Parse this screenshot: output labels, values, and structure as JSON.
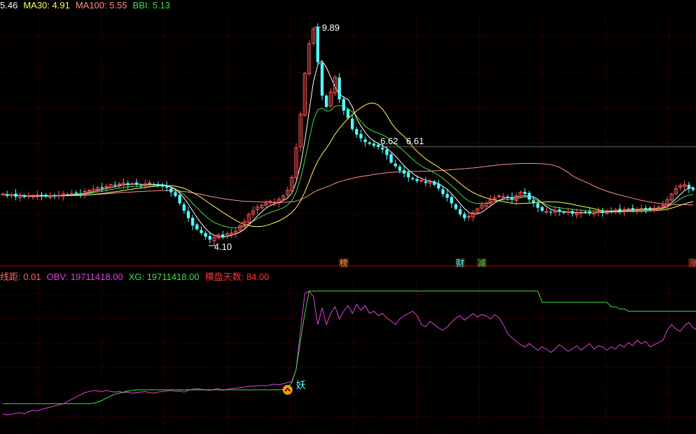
{
  "colors": {
    "background": "#000000",
    "grid": "#8b0000",
    "candle_up": "#ff5555",
    "candle_down": "#55ffff",
    "ma_short": "#ffffff",
    "ma30": "#ffff55",
    "ma100": "#ff8f8f",
    "bbi": "#44dd44",
    "obv": "#dd44dd",
    "xg": "#44dd44",
    "hengpan": "#ff3333",
    "yao_icon": "#ff9a00"
  },
  "main_panel": {
    "legend": [
      {
        "label": "",
        "value": "5.46",
        "color": "#ffffff"
      },
      {
        "label": "MA30: ",
        "value": "4.91",
        "color": "#ffff55"
      },
      {
        "label": "MA100: ",
        "value": "5.55",
        "color": "#ff8f8f"
      },
      {
        "label": "BBI: ",
        "value": "5.13",
        "color": "#44dd44"
      }
    ],
    "annotations": {
      "high_label": "9.89",
      "low_label": "4.10",
      "mid_label_1": "6.62",
      "mid_label_2": "6.61"
    },
    "event_tags": [
      {
        "text": "榜",
        "color": "#ff9a3c"
      },
      {
        "text": "财",
        "color": "#55ffff"
      },
      {
        "text": "减",
        "color": "#44dd44"
      },
      {
        "text": "涨",
        "color": "#ff4444"
      }
    ]
  },
  "sub_panel": {
    "legend": [
      {
        "label": "线距: ",
        "value": "0.01",
        "color": "#ff6666"
      },
      {
        "label": "OBV: ",
        "value": "19711418.00",
        "color": "#dd44dd"
      },
      {
        "label": "XG: ",
        "value": "19711418.00",
        "color": "#44dd44"
      },
      {
        "label": "横盘天数: ",
        "value": "84.00",
        "color": "#ff3333"
      }
    ],
    "signal_label": "妖"
  },
  "chart_data": [
    {
      "type": "candlestick",
      "panel": "price",
      "ylim": [
        3.6,
        10.2
      ],
      "bar_count": 166,
      "close": [
        5.35,
        5.3,
        5.33,
        5.28,
        5.31,
        5.27,
        5.3,
        5.29,
        5.32,
        5.3,
        5.28,
        5.31,
        5.29,
        5.32,
        5.35,
        5.33,
        5.36,
        5.38,
        5.35,
        5.42,
        5.45,
        5.48,
        5.52,
        5.5,
        5.55,
        5.6,
        5.58,
        5.62,
        5.65,
        5.6,
        5.63,
        5.6,
        5.57,
        5.62,
        5.65,
        5.6,
        5.58,
        5.55,
        5.52,
        5.4,
        5.3,
        5.1,
        4.9,
        4.7,
        4.5,
        4.4,
        4.3,
        4.2,
        4.12,
        4.18,
        4.25,
        4.2,
        4.28,
        4.3,
        4.35,
        4.5,
        4.6,
        4.8,
        4.9,
        5.0,
        5.05,
        5.1,
        5.15,
        5.12,
        5.2,
        5.3,
        5.45,
        5.8,
        6.6,
        7.5,
        8.6,
        9.4,
        9.8,
        8.9,
        8.0,
        7.7,
        8.1,
        8.5,
        7.9,
        7.6,
        7.4,
        7.1,
        6.95,
        6.85,
        6.75,
        6.7,
        6.65,
        6.62,
        6.55,
        6.4,
        6.2,
        6.1,
        5.98,
        5.9,
        5.8,
        5.75,
        5.7,
        5.72,
        5.65,
        5.68,
        5.6,
        5.5,
        5.35,
        5.25,
        5.1,
        4.95,
        4.8,
        4.7,
        4.75,
        4.85,
        4.95,
        5.05,
        5.1,
        5.2,
        5.25,
        5.3,
        5.28,
        5.25,
        5.2,
        5.3,
        5.4,
        5.35,
        5.2,
        5.1,
        4.98,
        4.9,
        4.88,
        4.85,
        4.9,
        4.88,
        4.85,
        4.87,
        4.82,
        4.84,
        4.86,
        4.85,
        4.83,
        4.85,
        4.88,
        4.86,
        4.9,
        4.88,
        4.92,
        4.9,
        4.93,
        4.95,
        4.92,
        4.94,
        4.96,
        4.95,
        4.93,
        4.97,
        5.0,
        5.05,
        5.2,
        5.35,
        5.5,
        5.58,
        5.6,
        5.5,
        5.46
      ],
      "overlays": [
        {
          "name": "MA30",
          "value_label": "4.91"
        },
        {
          "name": "MA100",
          "value_label": "5.55"
        },
        {
          "name": "BBI",
          "value_label": "5.13"
        }
      ]
    },
    {
      "type": "line",
      "panel": "indicator",
      "series": [
        {
          "name": "OBV",
          "values": [
            3.0,
            2.9,
            2.95,
            3.05,
            3.1,
            3.0,
            3.2,
            3.3,
            3.25,
            3.4,
            3.5,
            3.6,
            3.7,
            3.8,
            3.9,
            4.1,
            4.3,
            4.5,
            4.7,
            4.9,
            5.0,
            5.1,
            5.05,
            5.0,
            5.1,
            5.0,
            4.95,
            5.0,
            4.9,
            4.95,
            4.85,
            4.9,
            4.95,
            5.0,
            4.9,
            4.85,
            4.95,
            5.0,
            5.05,
            5.1,
            5.0,
            5.05,
            4.95,
            5.1,
            5.2,
            5.25,
            5.2,
            5.15,
            5.1,
            5.2,
            5.25,
            5.1,
            5.2,
            5.25,
            5.3,
            5.35,
            5.4,
            5.45,
            5.5,
            5.5,
            5.55,
            5.5,
            5.6,
            5.65,
            5.6,
            5.7,
            5.8,
            5.9,
            7.0,
            10.5,
            13.8,
            14.0,
            13.5,
            11.0,
            12.5,
            11.0,
            12.0,
            12.6,
            11.5,
            12.2,
            12.7,
            12.0,
            12.8,
            12.3,
            12.7,
            12.0,
            12.2,
            11.8,
            12.0,
            11.6,
            11.3,
            11.0,
            11.5,
            11.8,
            12.0,
            12.2,
            11.8,
            11.0,
            10.8,
            11.3,
            11.0,
            10.7,
            10.5,
            10.8,
            11.2,
            11.6,
            11.8,
            11.4,
            11.7,
            12.0,
            11.7,
            11.9,
            11.8,
            11.5,
            11.9,
            11.6,
            11.0,
            10.2,
            9.8,
            9.5,
            9.2,
            9.0,
            9.3,
            9.0,
            8.7,
            9.0,
            8.8,
            8.5,
            8.8,
            9.2,
            8.9,
            8.6,
            8.8,
            9.1,
            8.7,
            9.0,
            9.3,
            8.8,
            9.1,
            9.0,
            8.7,
            9.0,
            8.8,
            9.2,
            9.0,
            9.4,
            9.1,
            9.6,
            9.3,
            9.5,
            9.0,
            9.2,
            9.4,
            9.6,
            10.5,
            11.0,
            10.6,
            10.4,
            10.9,
            11.2,
            10.7,
            10.5
          ]
        },
        {
          "name": "XG",
          "values": [
            3.9,
            3.9,
            3.9,
            3.9,
            3.9,
            3.9,
            3.9,
            3.9,
            3.9,
            3.9,
            3.9,
            3.9,
            3.9,
            3.9,
            3.9,
            3.9,
            3.9,
            3.9,
            3.9,
            3.9,
            3.9,
            3.95,
            4.05,
            4.2,
            4.4,
            4.6,
            4.75,
            4.85,
            4.95,
            5.05,
            5.1,
            5.15,
            5.15,
            5.15,
            5.15,
            5.15,
            5.15,
            5.15,
            5.15,
            5.15,
            5.15,
            5.15,
            5.15,
            5.15,
            5.15,
            5.15,
            5.15,
            5.15,
            5.15,
            5.15,
            5.15,
            5.15,
            5.15,
            5.15,
            5.15,
            5.15,
            5.15,
            5.15,
            5.15,
            5.15,
            5.15,
            5.15,
            5.15,
            5.15,
            5.15,
            5.2,
            5.4,
            5.8,
            7.0,
            9.6,
            12.0,
            14.0,
            14.0,
            14.0,
            14.0,
            14.0,
            14.0,
            14.0,
            14.0,
            14.0,
            14.0,
            14.0,
            14.0,
            14.0,
            14.0,
            14.0,
            14.0,
            14.0,
            14.0,
            14.0,
            14.0,
            14.0,
            14.0,
            14.0,
            14.0,
            14.0,
            14.0,
            14.0,
            14.0,
            14.0,
            14.0,
            14.0,
            14.0,
            14.0,
            14.0,
            14.0,
            14.0,
            14.0,
            14.0,
            14.0,
            14.0,
            14.0,
            14.0,
            14.0,
            14.0,
            14.0,
            14.0,
            14.0,
            14.0,
            14.0,
            14.0,
            14.0,
            14.0,
            14.0,
            14.0,
            13.0,
            13.0,
            13.0,
            13.0,
            13.0,
            13.0,
            13.0,
            13.0,
            13.0,
            13.0,
            13.0,
            13.0,
            13.0,
            13.0,
            13.0,
            13.0,
            12.6,
            12.6,
            12.4,
            12.4,
            12.2,
            12.2,
            12.2,
            12.2,
            12.2,
            12.2,
            12.2,
            12.2,
            12.2,
            12.2,
            12.2,
            12.2,
            12.2,
            12.2,
            12.2,
            12.2,
            12.2,
            12.2,
            12.2
          ]
        }
      ],
      "ylim": [
        1.5,
        15.0
      ]
    }
  ]
}
